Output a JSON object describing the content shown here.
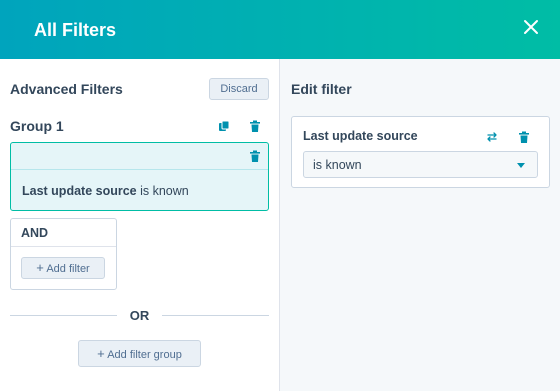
{
  "header": {
    "title": "All Filters",
    "close_icon": "close-icon"
  },
  "left_panel": {
    "title": "Advanced Filters",
    "discard_label": "Discard",
    "group": {
      "title": "Group 1",
      "copy_icon": "copy-icon",
      "delete_icon": "trash-icon",
      "filter": {
        "property": "Last update source",
        "operator": "is known",
        "delete_icon": "trash-icon"
      },
      "and_block": {
        "label": "AND",
        "add_filter_label": "Add filter"
      }
    },
    "or_label": "OR",
    "add_group_label": "Add filter group"
  },
  "right_panel": {
    "title": "Edit filter",
    "card": {
      "title": "Last update source",
      "swap_icon": "swap-icon",
      "delete_icon": "trash-icon",
      "select_value": "is known"
    }
  },
  "colors": {
    "header_start": "#00a4bd",
    "header_end": "#00bda5",
    "accent": "#0091ae",
    "selected_bg": "#e5f5f8"
  }
}
